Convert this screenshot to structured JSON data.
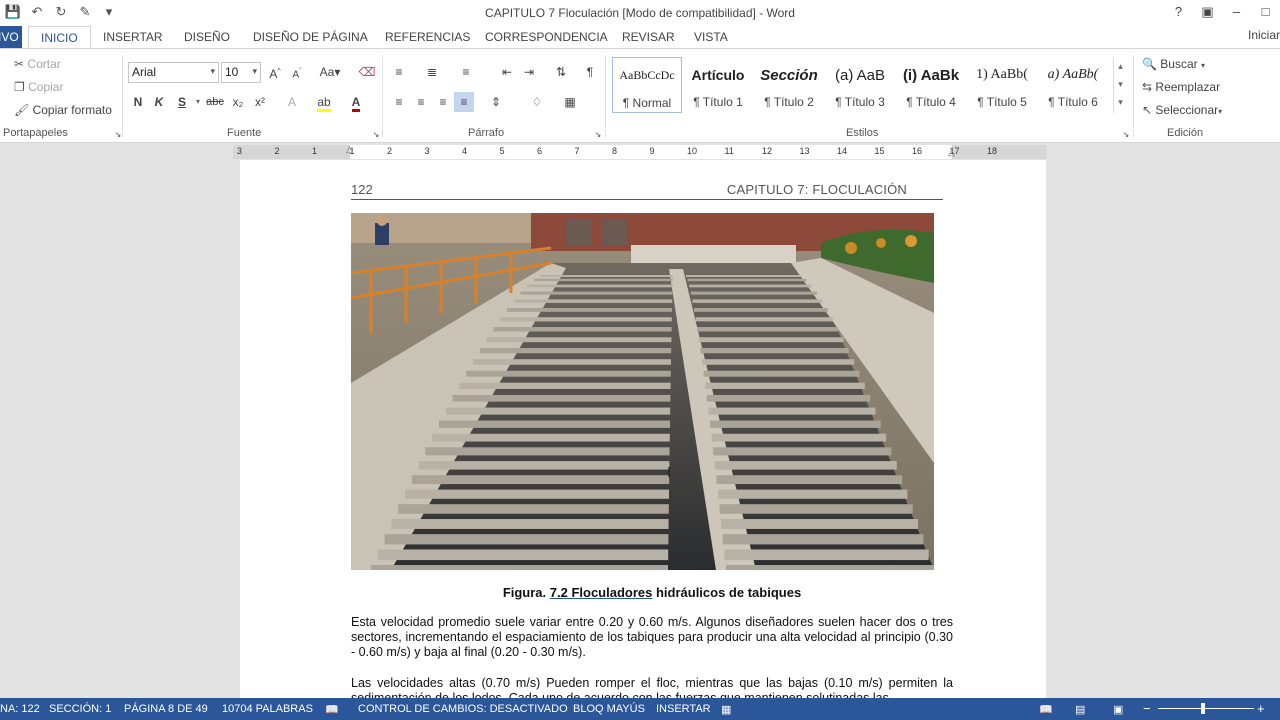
{
  "window": {
    "title": "CAPITULO 7 Floculación  [Modo de compatibilidad] - Word"
  },
  "qat": {
    "save": "save-icon",
    "undo": "undo-icon",
    "redo": "redo-icon"
  },
  "tabs": [
    {
      "label": "IVO"
    },
    {
      "label": "INICIO"
    },
    {
      "label": "INSERTAR"
    },
    {
      "label": "DISEÑO"
    },
    {
      "label": "DISEÑO DE PÁGINA"
    },
    {
      "label": "REFERENCIAS"
    },
    {
      "label": "CORRESPONDENCIA"
    },
    {
      "label": "REVISAR"
    },
    {
      "label": "VISTA"
    }
  ],
  "signin": "Iniciar",
  "clipboard": {
    "cut": "Cortar",
    "copy": "Copiar",
    "format": "Copiar formato",
    "label": "Portapapeles"
  },
  "font": {
    "name": "Arial",
    "size": "10",
    "label": "Fuente",
    "bold": "N",
    "italic": "K",
    "underline": "S",
    "strike": "abc",
    "sub": "x₂",
    "sup": "x²"
  },
  "paragraph": {
    "label": "Párrafo"
  },
  "styles": {
    "label": "Estilos",
    "items": [
      {
        "sample": "AaBbCcDc",
        "name": "¶ Normal"
      },
      {
        "sample": "Artículo",
        "name": "¶ Título 1"
      },
      {
        "sample": "Sección",
        "name": "¶ Título 2"
      },
      {
        "sample": "(a)  AaB",
        "name": "¶ Título 3"
      },
      {
        "sample": "(i)  AaBk",
        "name": "¶ Título 4"
      },
      {
        "sample": "1)  AaBb(",
        "name": "¶ Título 5"
      },
      {
        "sample": "a)  AaBb(",
        "name": "¶ Título 6"
      }
    ]
  },
  "editing": {
    "find": "Buscar",
    "replace": "Reemplazar",
    "select": "Seleccionar",
    "label": "Edición"
  },
  "ruler": [
    "3",
    "2",
    "1",
    "1",
    "2",
    "3",
    "4",
    "5",
    "6",
    "7",
    "8",
    "9",
    "10",
    "11",
    "12",
    "13",
    "14",
    "15",
    "16",
    "17",
    "18"
  ],
  "document": {
    "page_number": "122",
    "chapter": "CAPITULO 7: FLOCULACIÓN",
    "caption_prefix": "Figura. ",
    "caption_link": "7.2  Floculadores",
    "caption_rest": " hidráulicos de tabiques",
    "para1": "Esta velocidad promedio suele variar entre 0.20 y 0.60 m/s.  Algunos diseñadores suelen hacer dos o tres sectores, incrementando el espaciamiento de los tabiques para producir una alta velocidad al principio (0.30 - 0.60 m/s) y baja al final (0.20 - 0.30 m/s).",
    "para2": "Las velocidades altas (0.70 m/s) Pueden romper el floc, mientras que las bajas (0.10 m/s) permiten la sedimentación de los lodos. Cada uno de acuerdo con las fuerzas que mantienen solutinadas las"
  },
  "status": {
    "page": "NA: 122",
    "section": "SECCIÓN: 1",
    "pages": "PÁGINA 8 DE 49",
    "words": "10704 PALABRAS",
    "track": "CONTROL DE CAMBIOS: DESACTIVADO",
    "caps": "BLOQ MAYÚS",
    "insert": "INSERTAR",
    "zoom_minus": "−",
    "zoom_plus": "+"
  },
  "colors": {
    "accent": "#2b579a",
    "highlight": "#ffff00",
    "font_color": "#c00000"
  }
}
